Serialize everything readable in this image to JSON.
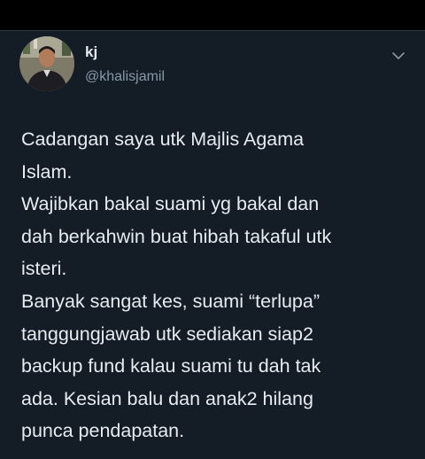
{
  "author": {
    "name": "kj",
    "handle": "@khalisjamil",
    "avatar_icon": "profile-photo",
    "more_icon": "chevron-down-icon"
  },
  "tweet": {
    "lines": [
      "Cadangan saya utk Majlis Agama",
      "Islam.",
      "Wajibkan bakal suami yg bakal dan",
      "dah berkahwin buat hibah takaful utk",
      "isteri.",
      "Banyak sangat kes, suami “terlupa”",
      "tanggungjawab utk sediakan siap2",
      "backup fund kalau suami tu dah tak",
      "ada. Kesian balu dan anak2 hilang",
      "punca pendapatan."
    ]
  },
  "colors": {
    "background": "#141d26",
    "text": "#e6ecf0",
    "secondary_text": "#8899a6"
  }
}
